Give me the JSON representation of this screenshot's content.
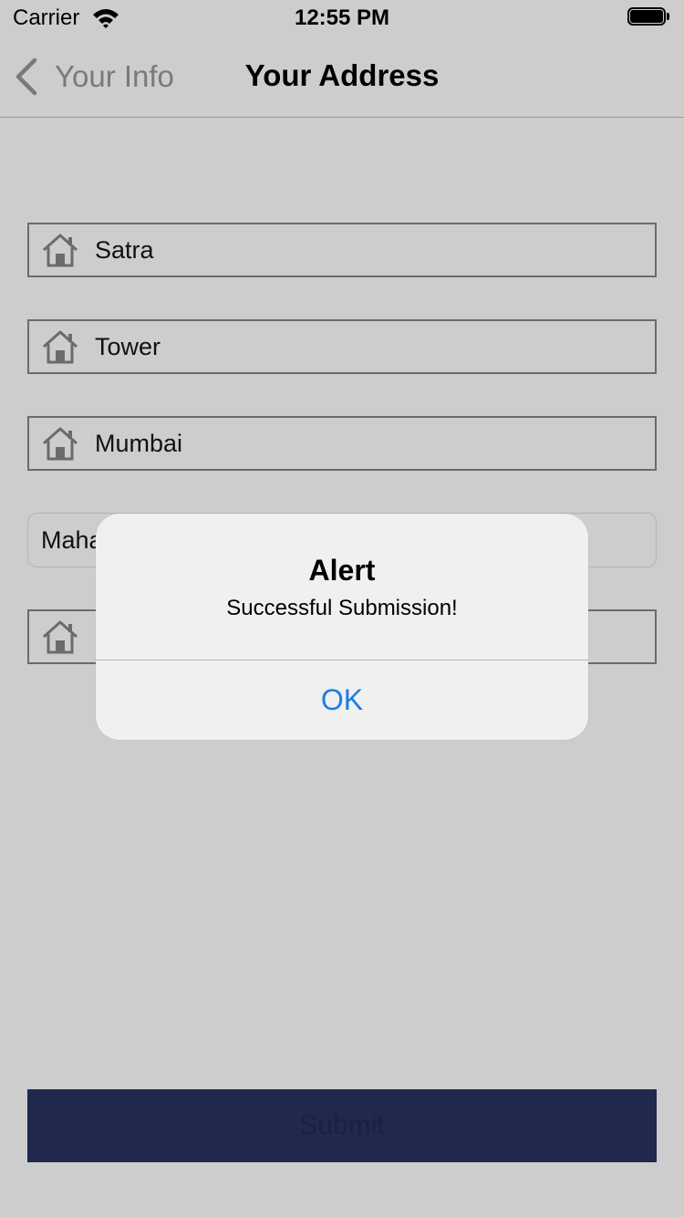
{
  "status_bar": {
    "carrier": "Carrier",
    "time": "12:55 PM",
    "wifi_icon": "wifi-icon",
    "battery_icon": "battery-full-icon"
  },
  "nav": {
    "back_label": "Your Info",
    "back_icon": "chevron-left-icon",
    "title": "Your Address"
  },
  "fields": [
    {
      "value": "Satra",
      "icon": "home-icon"
    },
    {
      "value": "Tower",
      "icon": "home-icon"
    },
    {
      "value": "Mumbai",
      "icon": "home-icon"
    },
    {
      "value": "Maha",
      "icon": null
    },
    {
      "value": "",
      "icon": "home-icon"
    }
  ],
  "submit": {
    "label": "Submit"
  },
  "alert": {
    "title": "Alert",
    "message": "Successful Submission!",
    "ok_label": "OK"
  },
  "colors": {
    "background": "#cdcdcd",
    "submit_button": "#20284e",
    "alert_action": "#1a7ee6",
    "field_border": "#6b6b6b"
  }
}
